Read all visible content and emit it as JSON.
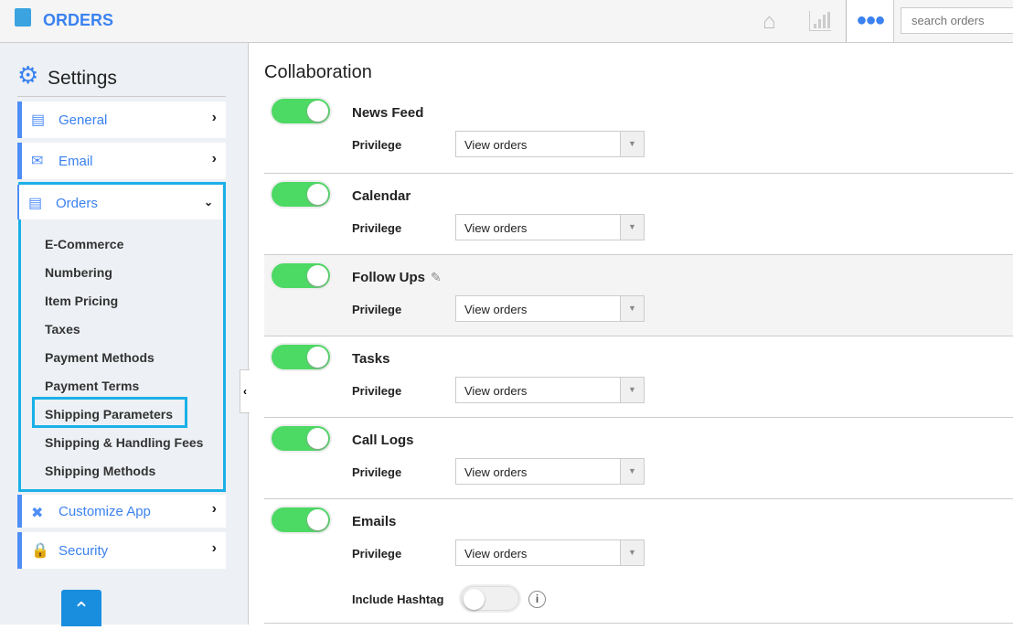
{
  "header": {
    "app_title": "ORDERS",
    "search_placeholder": "search orders",
    "icons": [
      "shopping-bag-icon",
      "home-icon",
      "bar-chart-icon",
      "more-icon"
    ],
    "accent": "#3b82f0"
  },
  "sidebar": {
    "title": "Settings",
    "items": [
      {
        "label": "General",
        "icon": "monitor-icon"
      },
      {
        "label": "Email",
        "icon": "envelope-icon"
      },
      {
        "label": "Orders",
        "icon": "orders-icon",
        "expanded": true
      },
      {
        "label": "Customize App",
        "icon": "tools-icon"
      },
      {
        "label": "Security",
        "icon": "lock-icon"
      }
    ],
    "orders_sub": [
      "E-Commerce",
      "Numbering",
      "Item Pricing",
      "Taxes",
      "Payment Methods",
      "Payment Terms",
      "Shipping Parameters",
      "Shipping & Handling Fees",
      "Shipping Methods"
    ],
    "highlight": "#1ab0e8"
  },
  "main": {
    "title": "Collaboration",
    "privilege_label": "Privilege",
    "sections": [
      {
        "name": "News Feed",
        "enabled": true,
        "privilege": "View orders"
      },
      {
        "name": "Calendar",
        "enabled": true,
        "privilege": "View orders"
      },
      {
        "name": "Follow Ups",
        "enabled": true,
        "privilege": "View orders"
      },
      {
        "name": "Tasks",
        "enabled": true,
        "privilege": "View orders"
      },
      {
        "name": "Call Logs",
        "enabled": true,
        "privilege": "View orders"
      },
      {
        "name": "Emails",
        "enabled": true,
        "privilege": "View orders"
      }
    ],
    "include_hashtag": {
      "label": "Include Hashtag",
      "enabled": false
    }
  }
}
